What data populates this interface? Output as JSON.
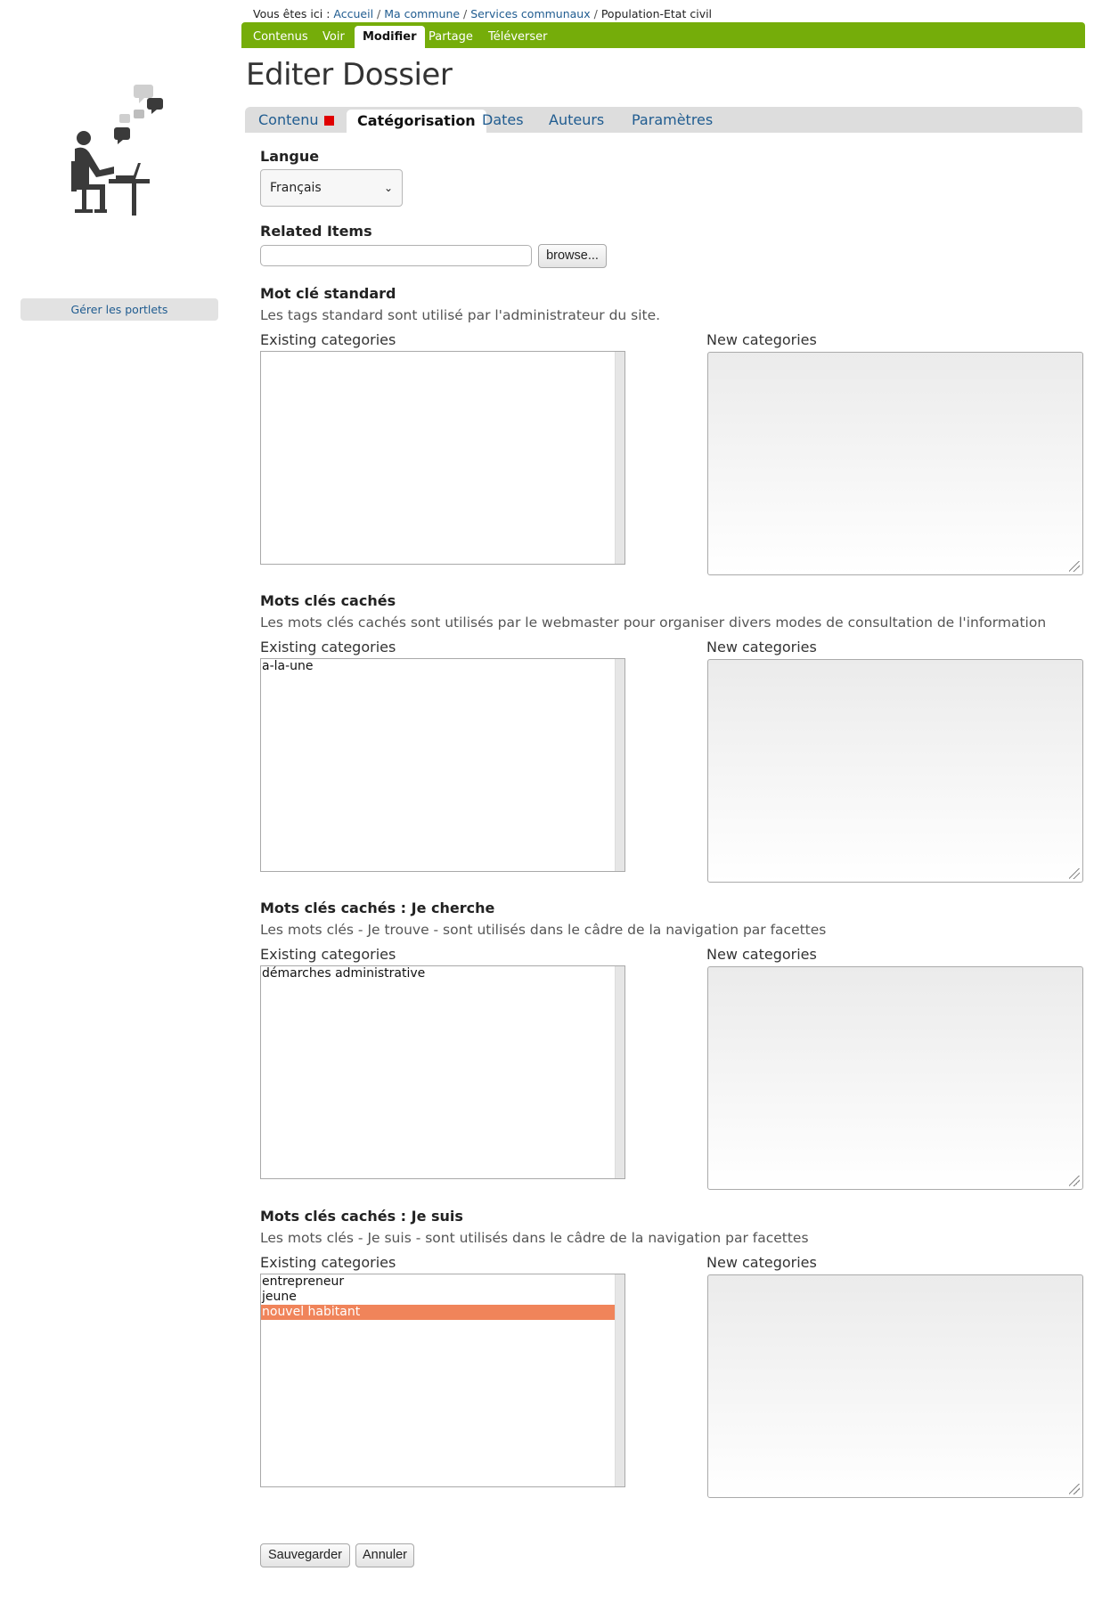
{
  "breadcrumb": {
    "prefix": "Vous êtes ici :",
    "items": [
      "Accueil",
      "Ma commune",
      "Services communaux",
      "Population-Etat civil"
    ],
    "separator": "/"
  },
  "toolbar": {
    "items": [
      "Contenus",
      "Voir",
      "Modifier",
      "Partage",
      "Téléverser"
    ],
    "active": "Modifier",
    "color": "#75ad0a"
  },
  "sidebar": {
    "logo_icon": "person-at-desk-chat-icon",
    "portlets_button": "Gérer les portlets"
  },
  "page_title": "Editer Dossier",
  "form_tabs": {
    "items": [
      "Contenu",
      "Catégorisation",
      "Dates",
      "Auteurs",
      "Paramètres"
    ],
    "active": "Catégorisation"
  },
  "form": {
    "language": {
      "label": "Langue",
      "value": "Français"
    },
    "related": {
      "label": "Related Items",
      "value": "",
      "browse_label": "browse..."
    },
    "existing_label": "Existing categories",
    "new_label": "New categories",
    "sections": [
      {
        "label": "Mot clé standard",
        "help": "Les tags standard sont utilisé par l'administrateur du site.",
        "existing": [],
        "selected": []
      },
      {
        "label": "Mots clés cachés",
        "help": "Les mots clés cachés sont utilisés par le webmaster pour organiser divers modes de consultation de l'information",
        "existing": [
          "a-la-une"
        ],
        "selected": []
      },
      {
        "label": "Mots clés cachés : Je cherche",
        "help": "Les mots clés - Je trouve - sont utilisés dans le câdre de la navigation par facettes",
        "existing": [
          "démarches administrative"
        ],
        "selected": []
      },
      {
        "label": "Mots clés cachés : Je suis",
        "help": "Les mots clés - Je suis - sont utilisés dans le câdre de la navigation par facettes",
        "existing": [
          "entrepreneur",
          "jeune",
          "nouvel habitant"
        ],
        "selected": [
          "nouvel habitant"
        ]
      }
    ],
    "save_label": "Sauvegarder",
    "cancel_label": "Annuler"
  },
  "colors": {
    "link": "#205c90",
    "selected_option": "#f0845a",
    "required": "#e00000"
  }
}
